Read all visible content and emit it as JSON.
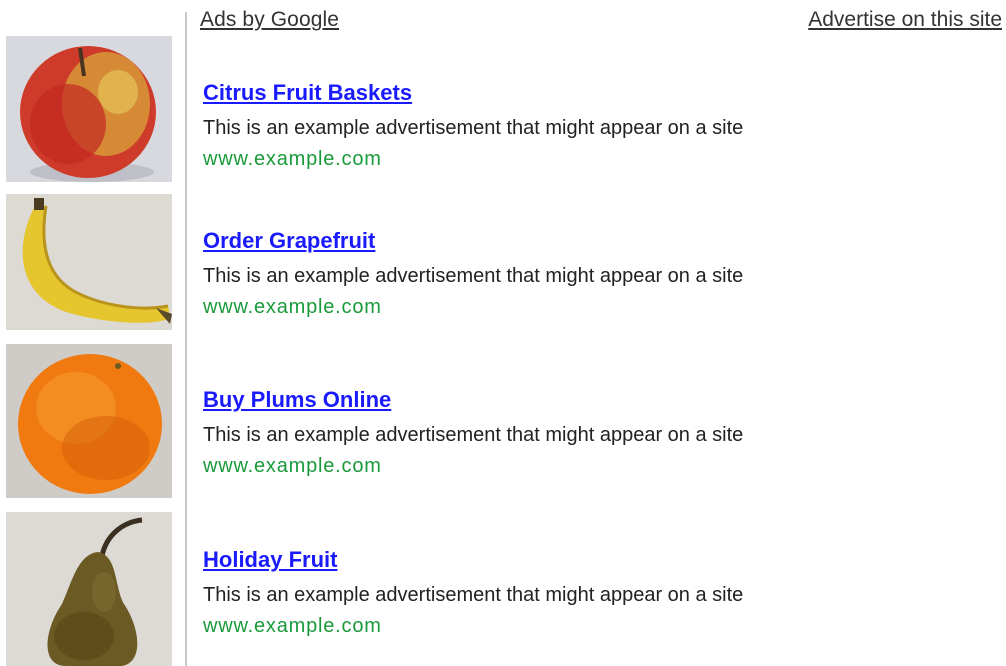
{
  "header": {
    "ads_by_label": "Ads by Google",
    "advertise_label": "Advertise on this site"
  },
  "thumbnails": [
    {
      "fruit": "apple",
      "icon": "apple-icon"
    },
    {
      "fruit": "banana",
      "icon": "banana-icon"
    },
    {
      "fruit": "orange",
      "icon": "orange-icon"
    },
    {
      "fruit": "pear",
      "icon": "pear-icon"
    }
  ],
  "ads": [
    {
      "title": "Citrus Fruit Baskets",
      "description": "This is an example advertisement that might appear on a site",
      "url": "www.example.com"
    },
    {
      "title": "Order Grapefruit",
      "description": "This is an example advertisement that might appear on a site",
      "url": "www.example.com"
    },
    {
      "title": "Buy Plums Online",
      "description": "This is an example advertisement that might appear on a site",
      "url": "www.example.com"
    },
    {
      "title": "Holiday Fruit",
      "description": "This is an example advertisement that might appear on a site",
      "url": "www.example.com"
    }
  ],
  "colors": {
    "title_link": "#1a1aff",
    "url_text": "#1a9a3a",
    "body_text": "#222222",
    "header_text": "#333333"
  }
}
